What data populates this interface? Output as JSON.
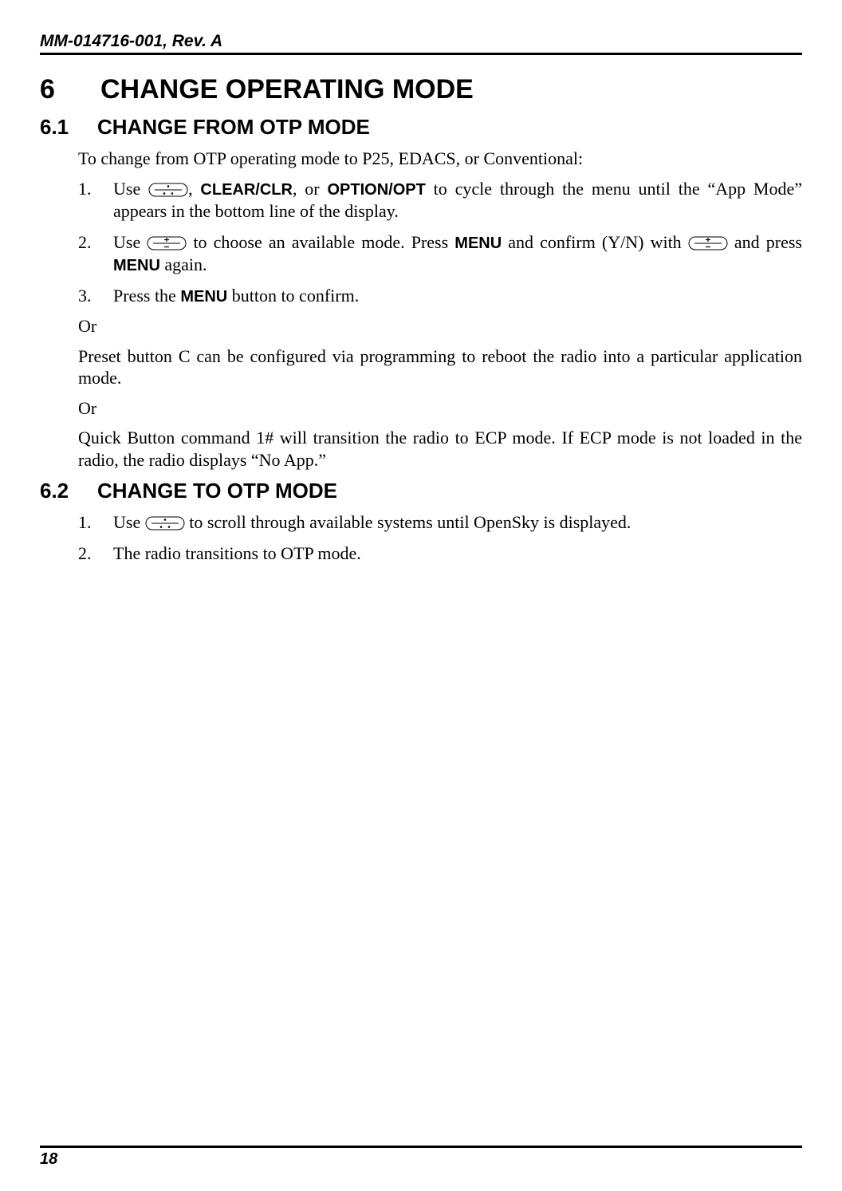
{
  "header": "MM-014716-001, Rev. A",
  "section6": {
    "num": "6",
    "title": "CHANGE OPERATING MODE"
  },
  "section61": {
    "num": "6.1",
    "title": "CHANGE FROM OTP MODE",
    "intro": "To change from OTP operating mode to P25, EDACS, or Conventional:",
    "li1_a": "Use ",
    "li1_b": ", ",
    "li1_clearclr": "CLEAR/CLR",
    "li1_c": ", or ",
    "li1_optionopt": "OPTION/OPT",
    "li1_d": " to cycle through the menu until the “App Mode” appears in the bottom line of the display.",
    "li2_a": "Use ",
    "li2_b": " to choose an available mode. Press ",
    "li2_menu1": "MENU",
    "li2_c": " and confirm (Y/N) with ",
    "li2_d": " and press ",
    "li2_menu2": "MENU",
    "li2_e": " again.",
    "li3_a": "Press the ",
    "li3_menu": "MENU",
    "li3_b": " button to confirm.",
    "or": "Or",
    "presetC": "Preset button C can be configured via programming to reboot the radio into a particular application mode.",
    "quick": "Quick Button command 1# will transition the radio to ECP mode. If ECP mode is not loaded in the radio, the radio displays “No App.”"
  },
  "section62": {
    "num": "6.2",
    "title": "CHANGE TO OTP MODE",
    "li1_a": "Use ",
    "li1_b": " to scroll through available systems until OpenSky is displayed.",
    "li2": "The radio transitions to OTP mode."
  },
  "pageNumber": "18",
  "icons": {
    "triangle": "triangle-dots-icon",
    "plusminus": "plus-minus-icon"
  }
}
